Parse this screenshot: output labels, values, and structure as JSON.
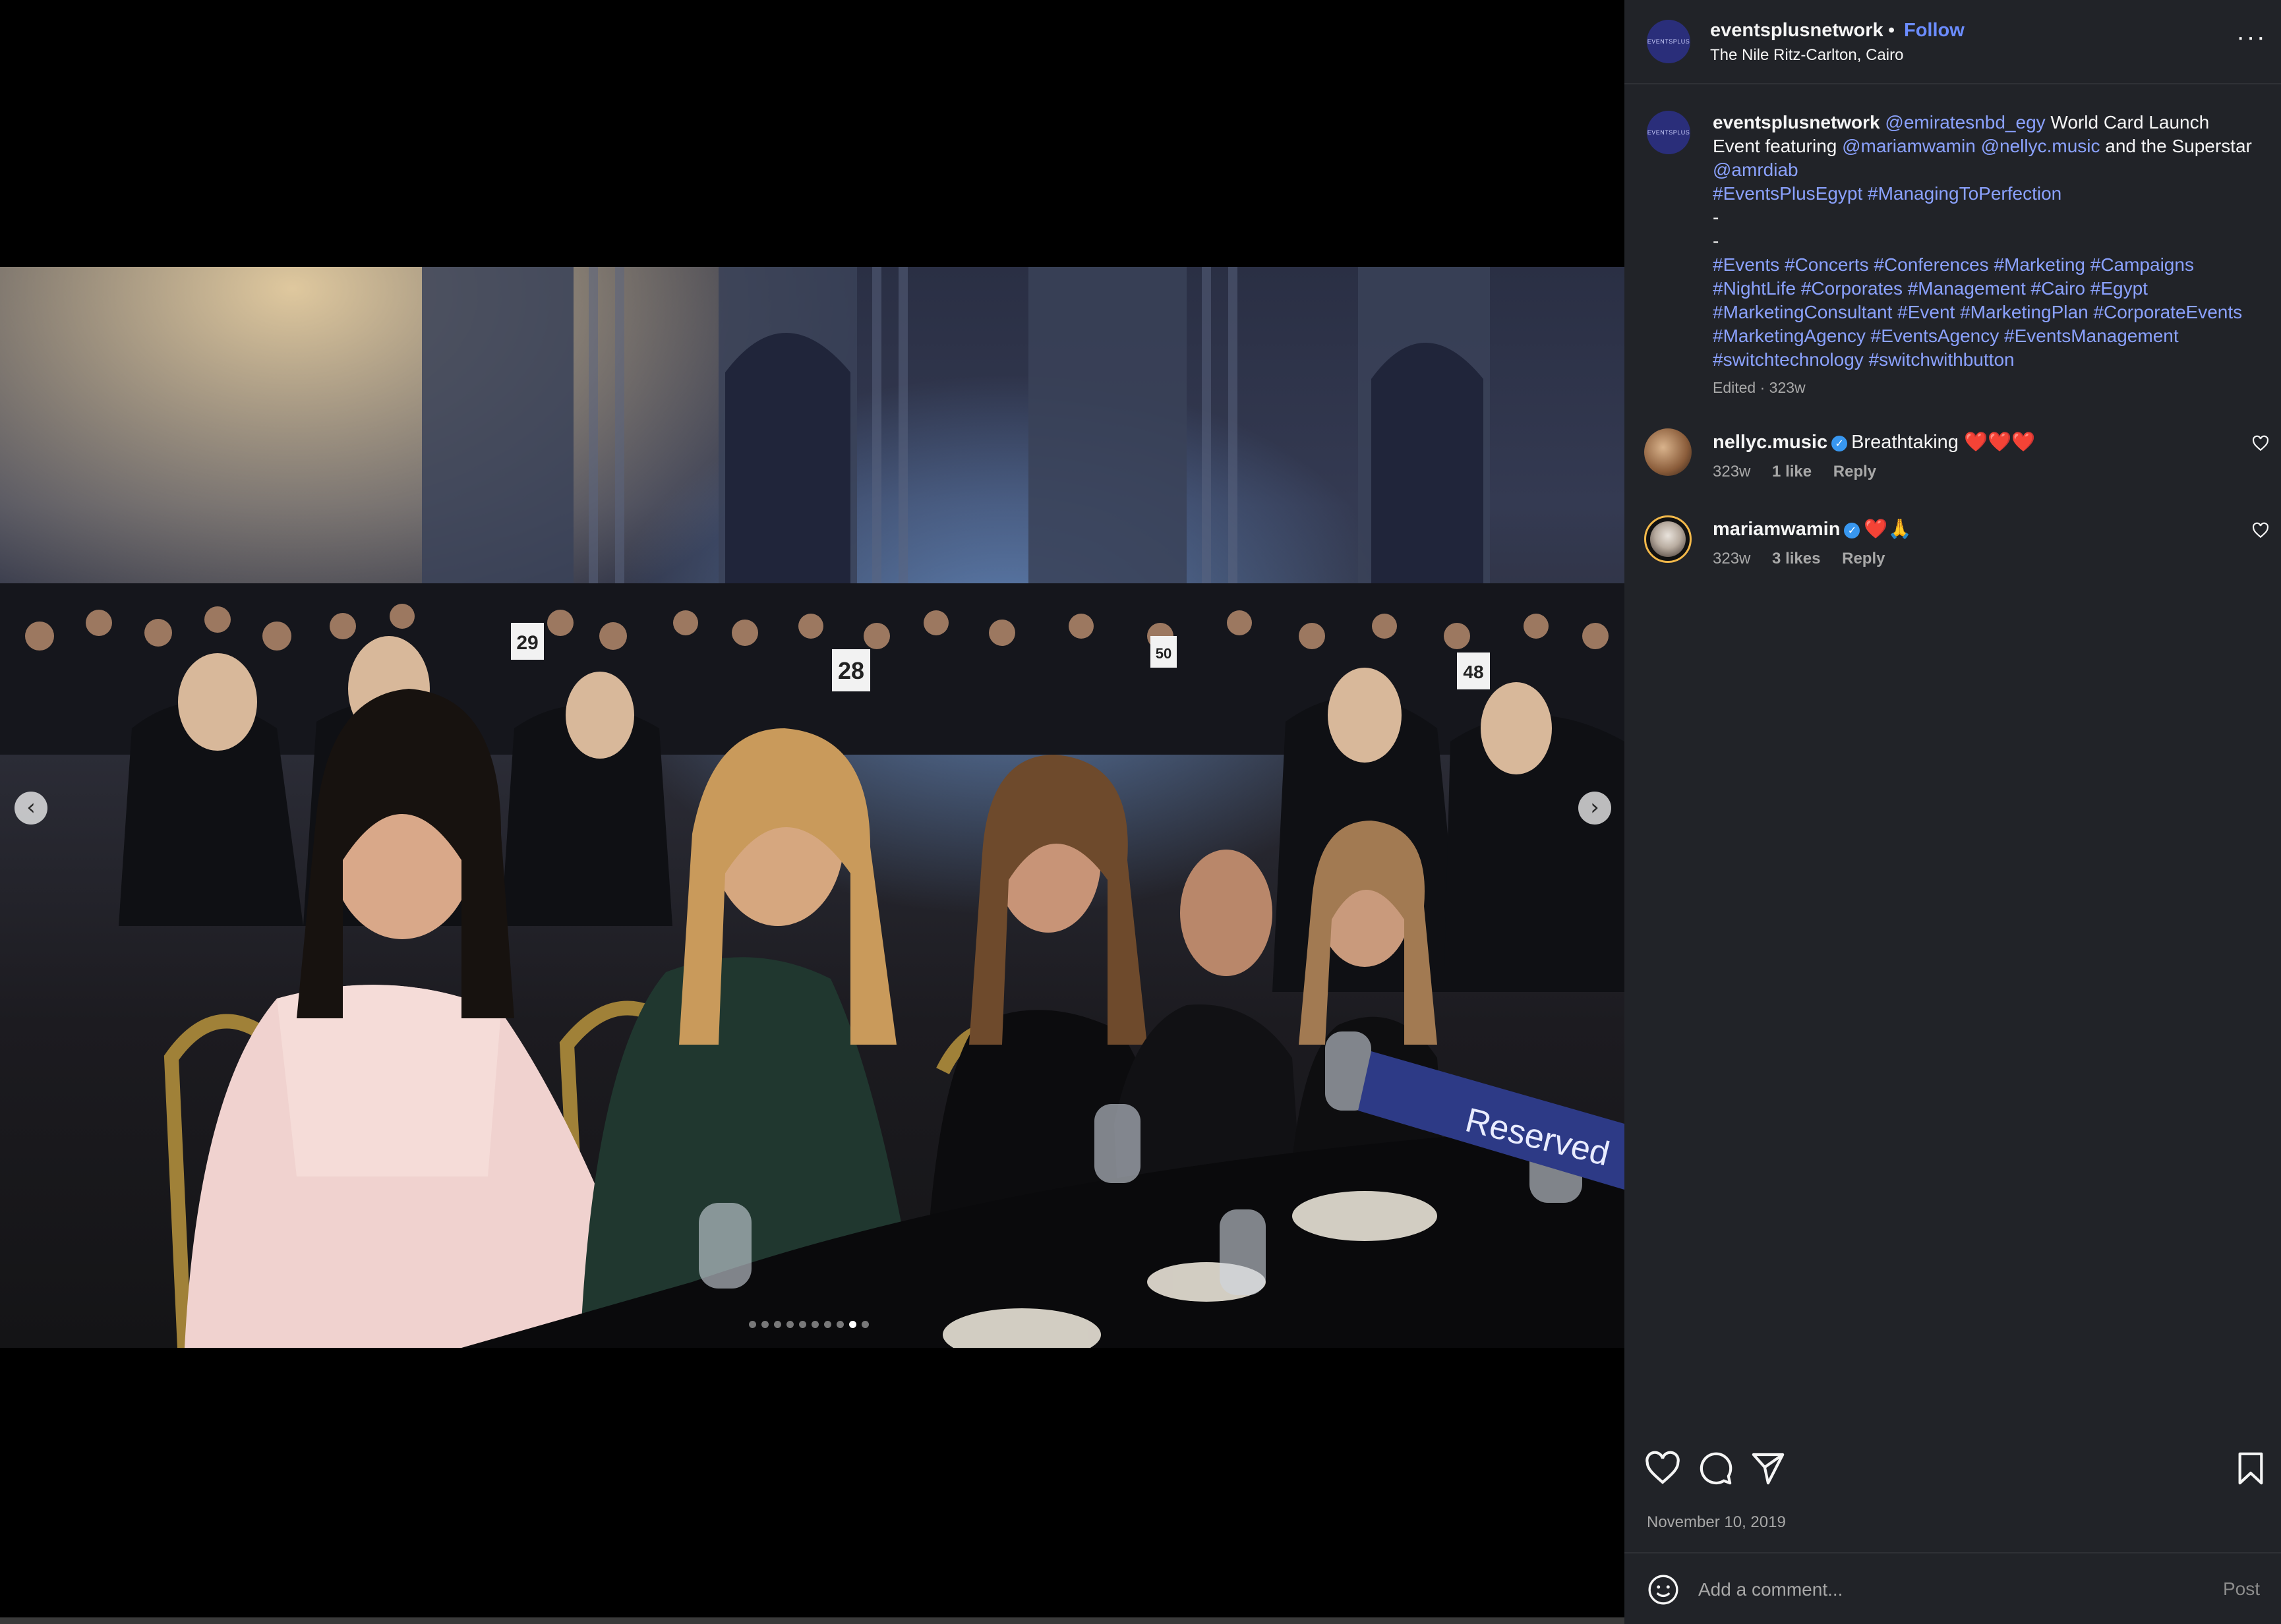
{
  "header": {
    "username": "eventsplusnetwork",
    "separator": "•",
    "follow_label": "Follow",
    "location": "The Nile Ritz-Carlton, Cairo",
    "more_icon": "more-horizontal-icon",
    "avatar_text": "EVENTSPLUS"
  },
  "caption": {
    "username": "eventsplusnetwork",
    "mention_1": "@emiratesnbd_egy",
    "text_1": " World Card Launch Event featuring ",
    "mention_2": "@mariamwamin",
    "mention_3": "@nellyc.music",
    "text_2": " and the Superstar ",
    "mention_4": "@amrdiab",
    "tags_line_1": "#EventsPlusEgypt #ManagingToPerfection",
    "dash_1": "-",
    "dash_2": "-",
    "tags_line_2": "#Events #Concerts #Conferences #Marketing #Campaigns #NightLife #Corporates #Management #Cairo #Egypt #MarketingConsultant #Event #MarketingPlan #CorporateEvents #MarketingAgency #EventsAgency #EventsManagement #switchtechnology #switchwithbutton",
    "edited": "Edited · 323w"
  },
  "comments": [
    {
      "username": "nellyc.music",
      "text": "Breathtaking ❤️❤️❤️",
      "time": "323w",
      "likes": "1 like",
      "reply_label": "Reply"
    },
    {
      "username": "mariamwamin",
      "text": "❤️🙏",
      "time": "323w",
      "likes": "3 likes",
      "reply_label": "Reply"
    }
  ],
  "post_date": "November 10, 2019",
  "comment_box": {
    "placeholder": "Add a comment...",
    "post_label": "Post"
  },
  "carousel": {
    "prev_glyph": "‹",
    "next_glyph": "›",
    "total_slides": 10,
    "active_slide": 9
  },
  "photo": {
    "table_numbers": [
      "29",
      "28",
      "50",
      "48"
    ],
    "reserved_sign": "Reserved"
  },
  "colors": {
    "panel_bg": "#212328",
    "link": "#8ba2ff",
    "follow": "#6b8cff",
    "verified": "#3897f0"
  }
}
